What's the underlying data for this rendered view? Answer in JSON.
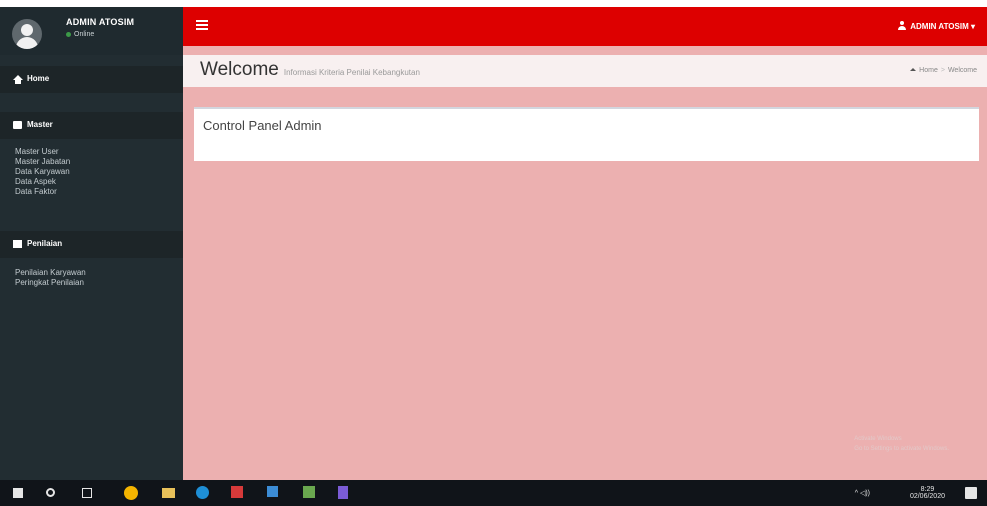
{
  "sidebar": {
    "user_name": "ADMIN ATOSIM",
    "user_status": "Online",
    "home_label": "Home",
    "master_label": "Master",
    "master_items": [
      "Master User",
      "Master Jabatan",
      "Data Karyawan",
      "Data Aspek",
      "Data Faktor"
    ],
    "penilaian_label": "Penilaian",
    "penilaian_items": [
      "Penilaian Karyawan",
      "Peringkat Penilaian"
    ]
  },
  "header": {
    "admin_label": "ADMIN ATOSIM"
  },
  "content": {
    "title": "Welcome",
    "subtitle": "Informasi Kriteria Penilai Kebangkutan",
    "breadcrumb": [
      "Home",
      "Welcome"
    ],
    "panel_title": "Control Panel Admin",
    "watermark": [
      "Activate Windows",
      "Go to Settings to activate Windows."
    ]
  },
  "taskbar": {
    "time": "8:29",
    "date": "02/06/2020"
  },
  "colors": {
    "header_red": "#dd0000",
    "content_bg": "#ecb0b0",
    "sidebar_bg": "#222d32"
  },
  "icons": [
    "user-avatar-icon",
    "home-icon",
    "master-icon",
    "chart-icon",
    "hamburger-icon",
    "user-icon"
  ]
}
